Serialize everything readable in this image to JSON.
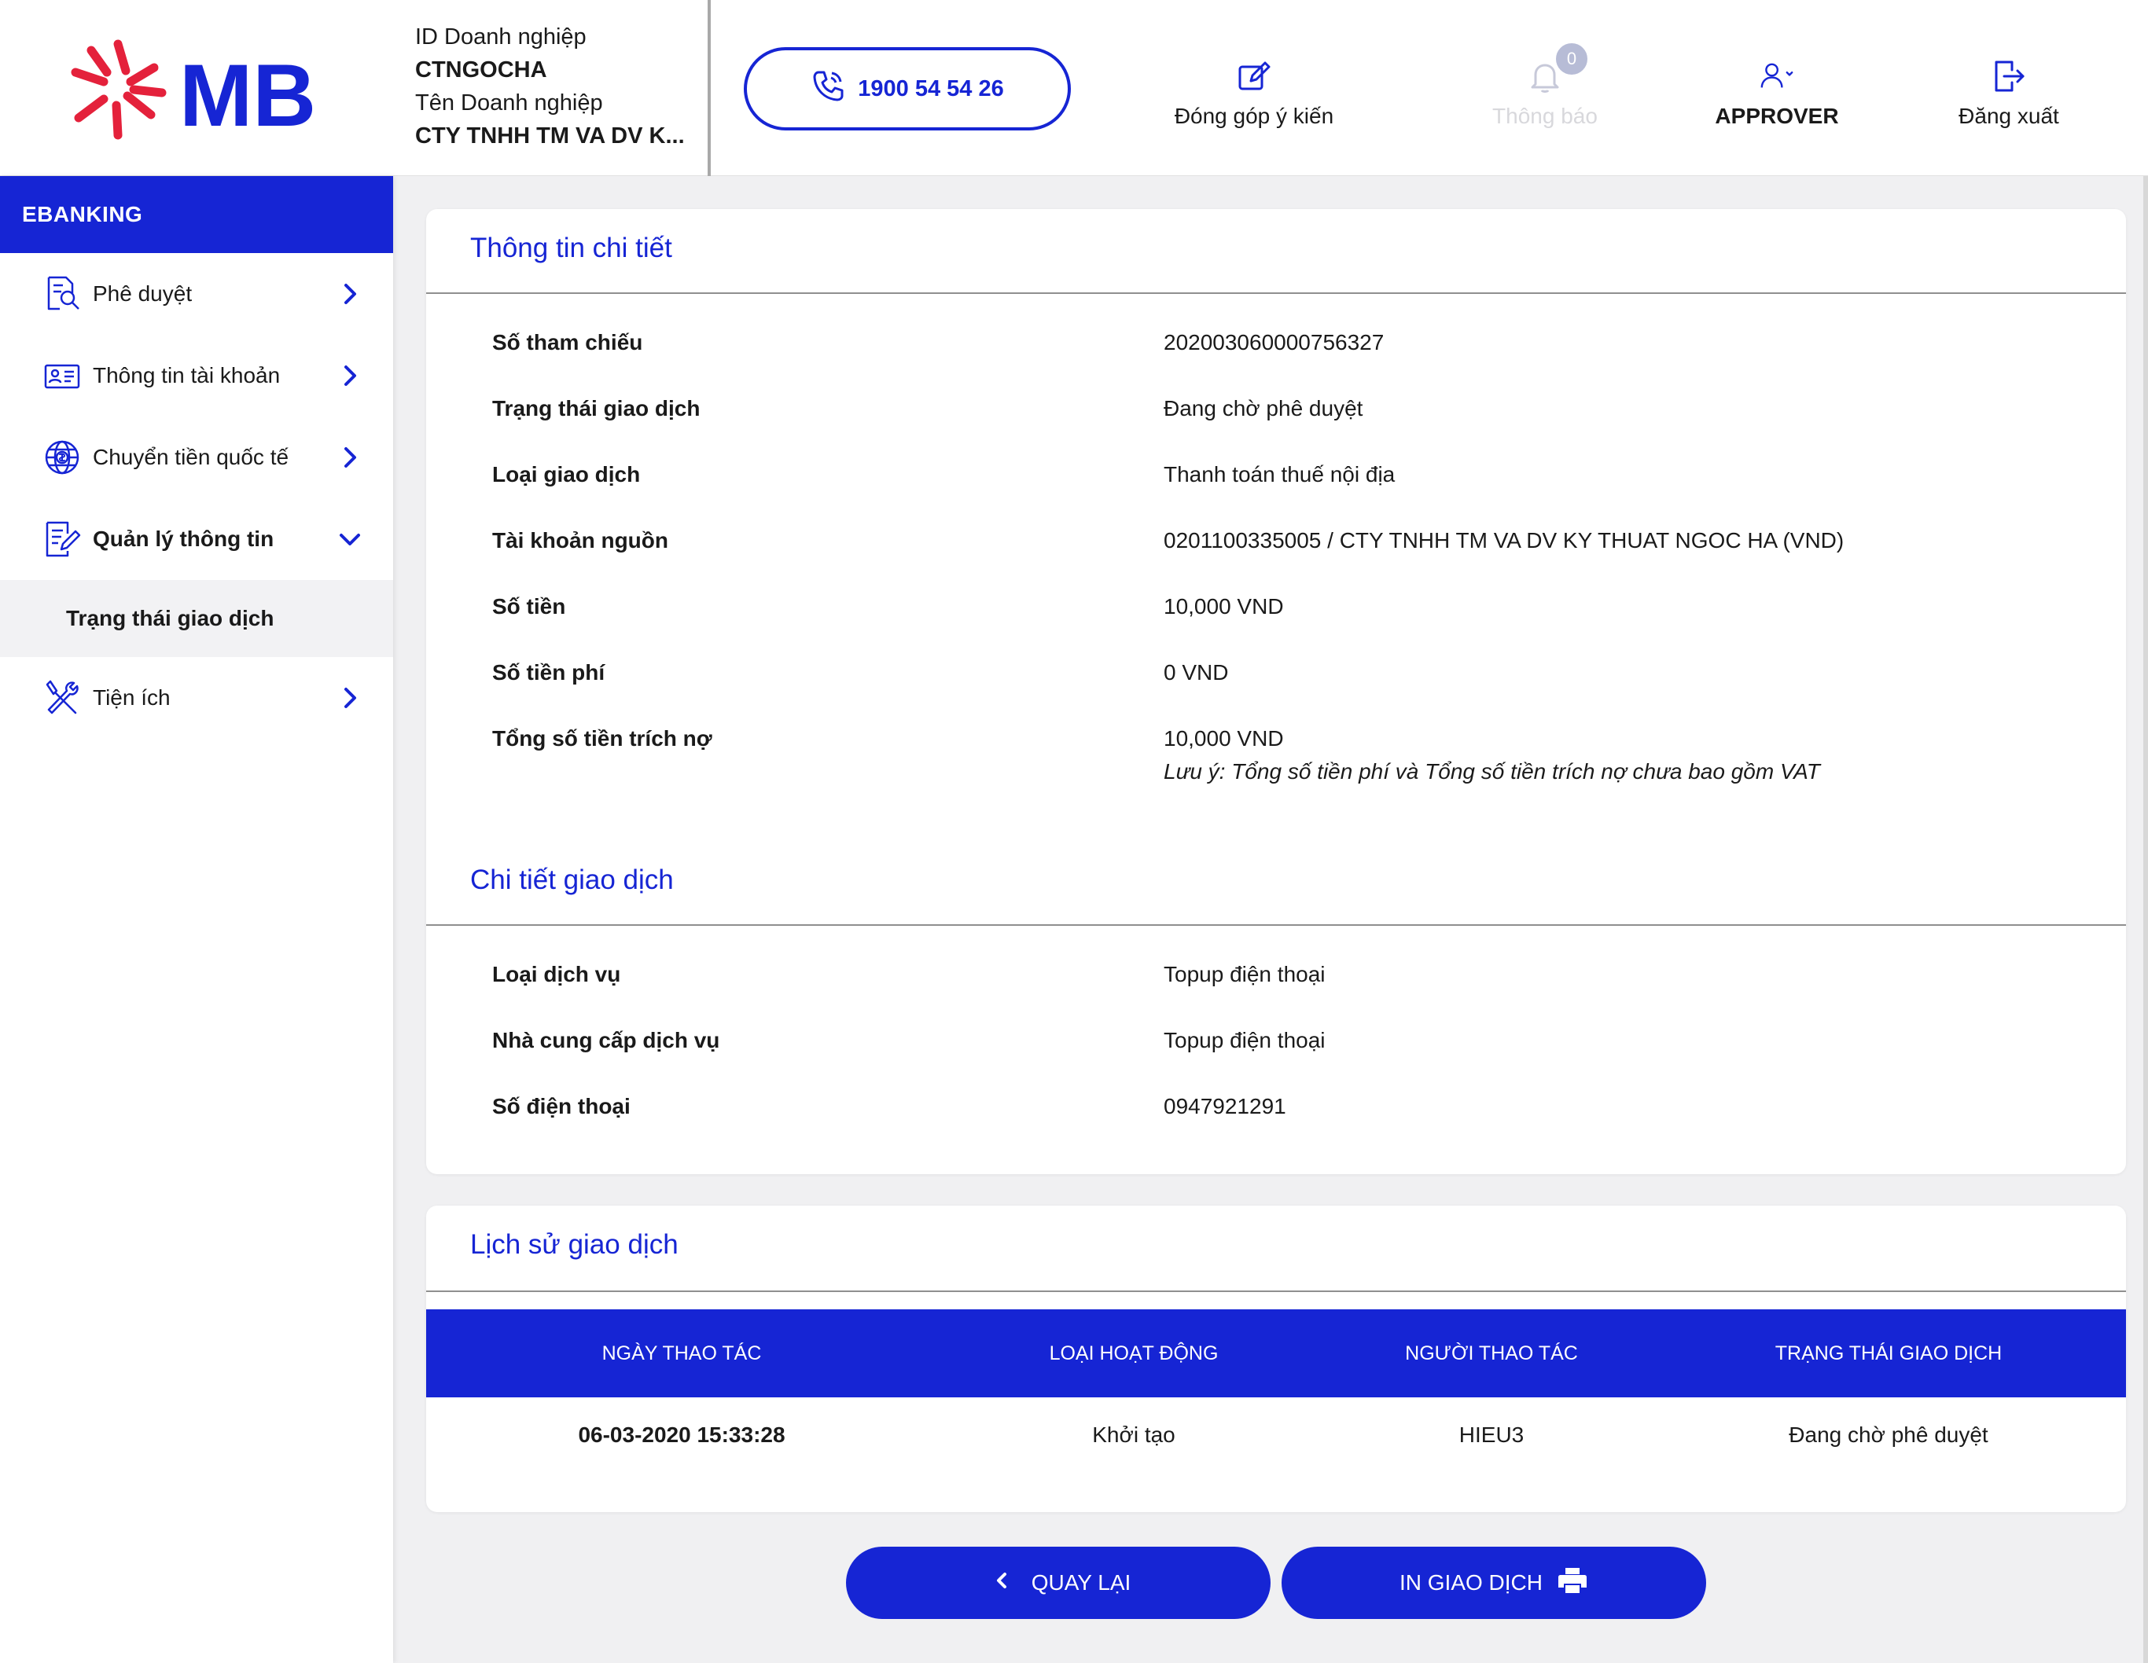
{
  "brand": {
    "logo_text": "MB",
    "accent": "#1625d4",
    "logo_red": "#e4213b"
  },
  "header": {
    "company_id_label": "ID Doanh nghiệp",
    "company_id": "CTNGOCHA",
    "company_name_label": "Tên Doanh nghiệp",
    "company_name": "CTY TNHH TM VA DV K...",
    "hotline": "1900 54 54 26",
    "feedback": "Đóng góp ý kiến",
    "notifications": "Thông báo",
    "notification_count": "0",
    "user_role": "APPROVER",
    "logout": "Đăng xuất"
  },
  "sidebar": {
    "title": "EBANKING",
    "items": [
      {
        "label": "Phê duyệt",
        "icon": "approve-icon"
      },
      {
        "label": "Thông tin tài khoản",
        "icon": "account-card-icon"
      },
      {
        "label": "Chuyển tiền quốc tế",
        "icon": "globe-money-icon"
      },
      {
        "label": "Quản lý thông tin",
        "icon": "document-edit-icon",
        "expanded": true
      },
      {
        "label": "Tiện ích",
        "icon": "tools-icon"
      }
    ],
    "sub_item": "Trạng thái giao dịch"
  },
  "detail": {
    "title": "Thông tin chi tiết",
    "rows": [
      {
        "label": "Số tham chiếu",
        "value": "202003060000756327"
      },
      {
        "label": "Trạng thái giao dịch",
        "value": "Đang chờ phê duyệt"
      },
      {
        "label": "Loại giao dịch",
        "value": "Thanh toán thuế nội địa"
      },
      {
        "label": "Tài khoản nguồn",
        "value": "0201100335005 / CTY TNHH TM VA DV KY THUAT NGOC HA (VND)"
      },
      {
        "label": "Số tiền",
        "value": "10,000 VND"
      },
      {
        "label": "Số tiền phí",
        "value": "0 VND"
      },
      {
        "label": "Tổng số tiền trích nợ",
        "value": "10,000 VND"
      }
    ],
    "note": "Lưu ý: Tổng số tiền phí và Tổng số tiền trích nợ chưa bao gồm VAT"
  },
  "transaction": {
    "title": "Chi tiết giao dịch",
    "rows": [
      {
        "label": "Loại dịch vụ",
        "value": "Topup điện thoại"
      },
      {
        "label": "Nhà cung cấp dịch vụ",
        "value": "Topup điện thoại"
      },
      {
        "label": "Số điện thoại",
        "value": "0947921291"
      }
    ]
  },
  "history": {
    "title": "Lịch sử giao dịch",
    "columns": [
      "NGÀY THAO TÁC",
      "LOẠI HOẠT ĐỘNG",
      "NGƯỜI THAO TÁC",
      "TRẠNG THÁI GIAO DỊCH"
    ],
    "rows": [
      [
        "06-03-2020 15:33:28",
        "Khởi tạo",
        "HIEU3",
        "Đang chờ phê duyệt"
      ]
    ]
  },
  "actions": {
    "back": "QUAY LẠI",
    "print": "IN GIAO DỊCH"
  }
}
